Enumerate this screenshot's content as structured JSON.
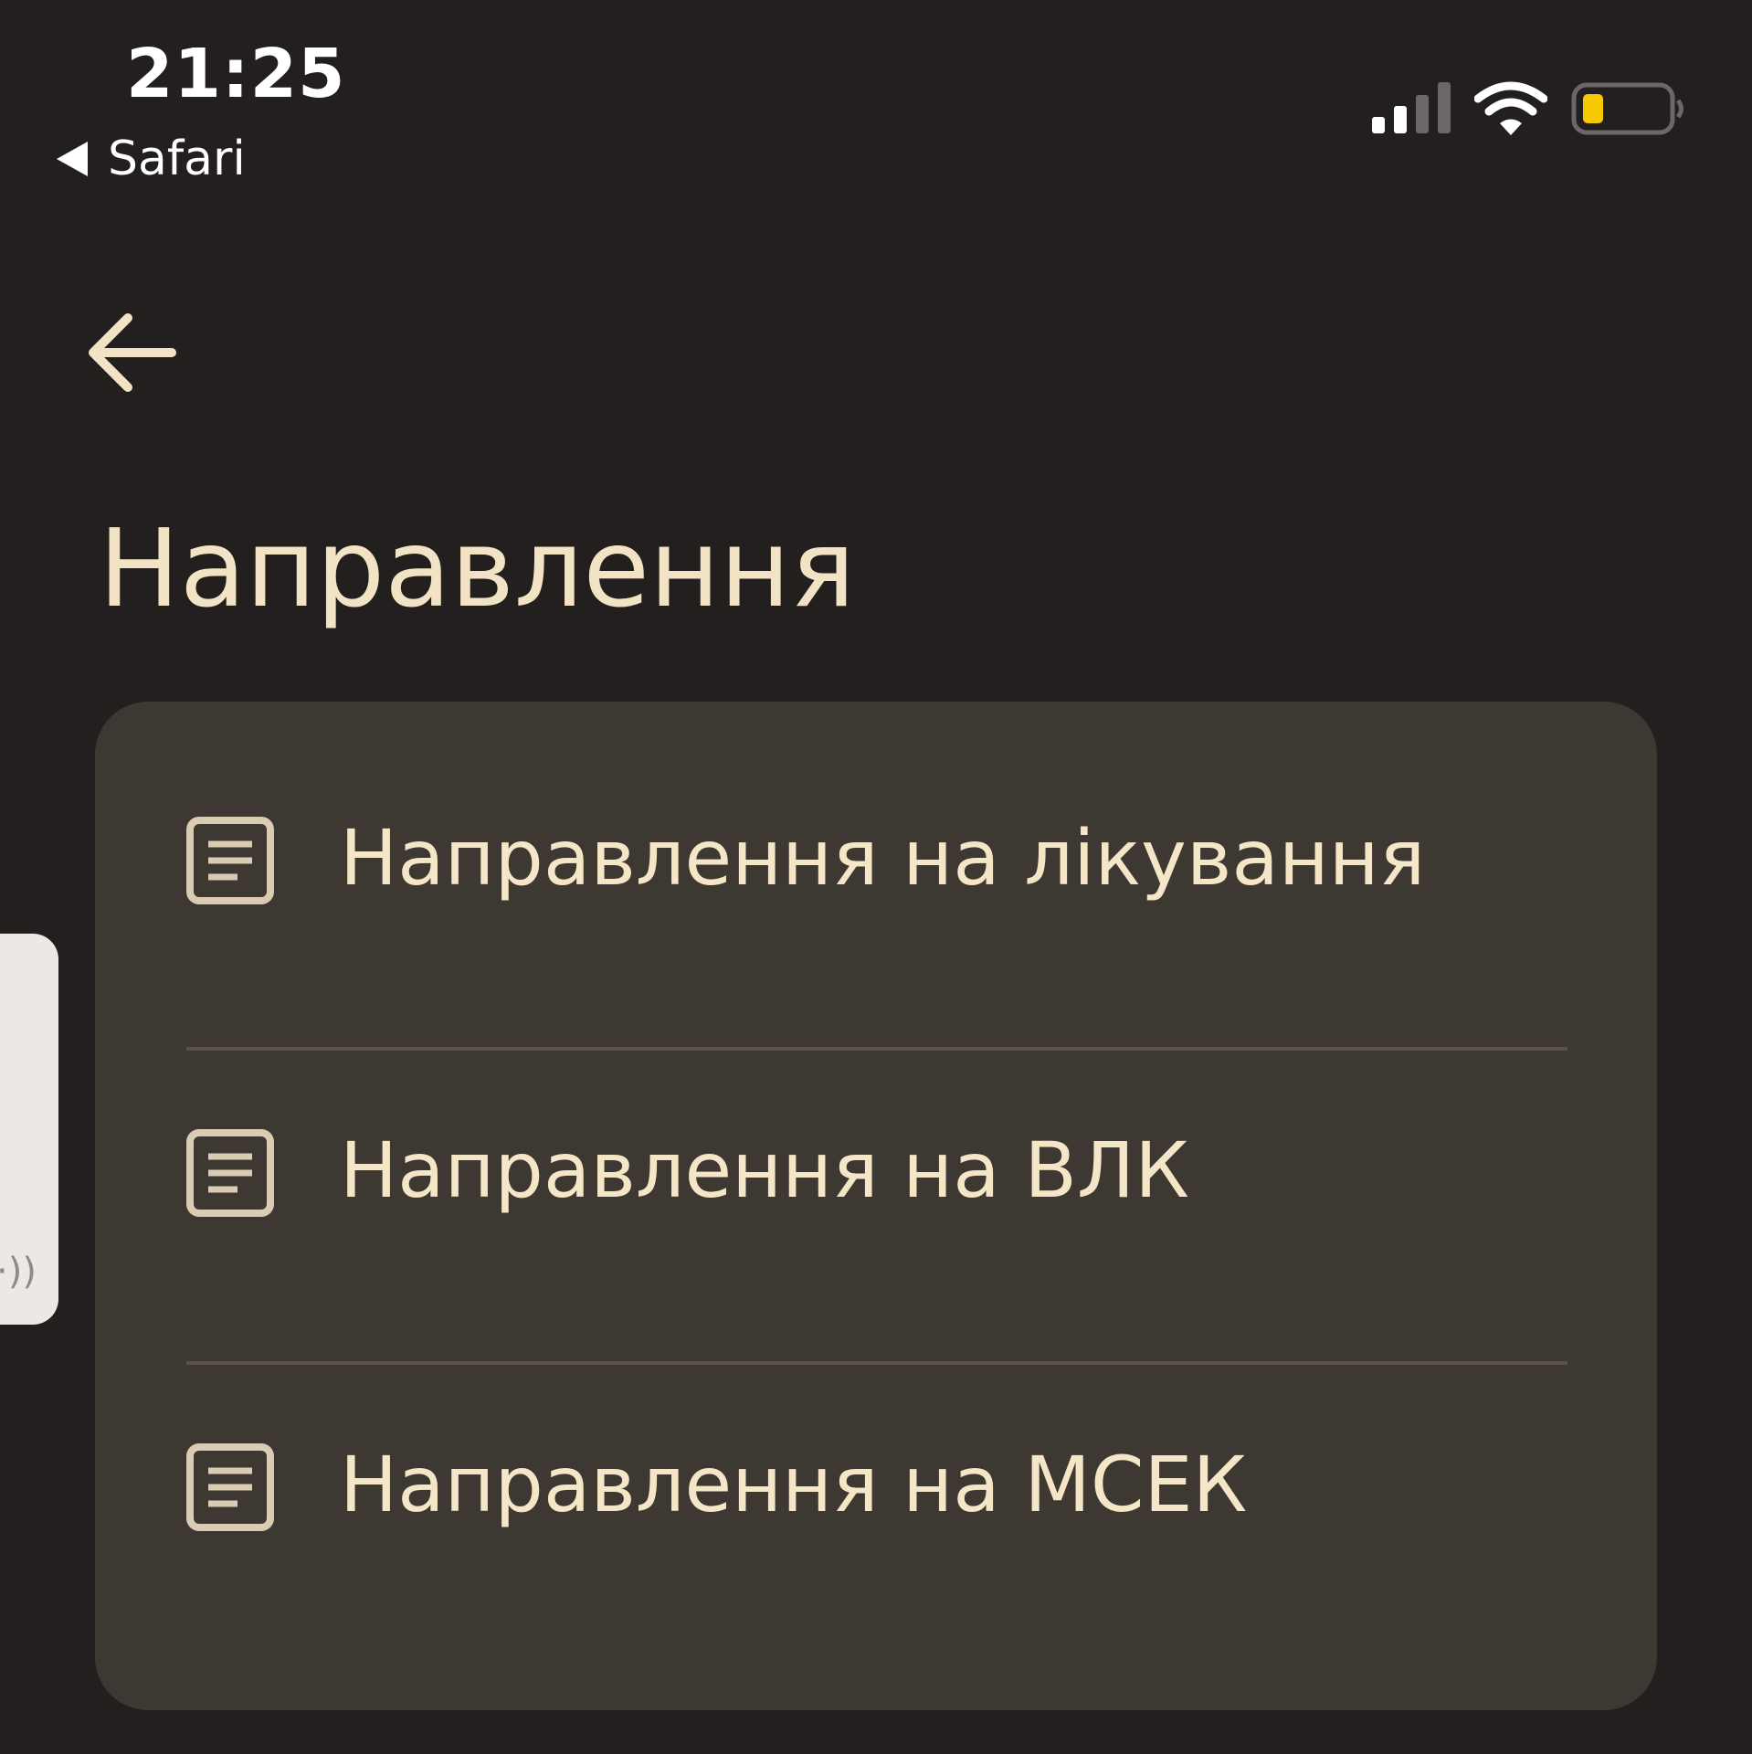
{
  "status_bar": {
    "time": "21:25",
    "back_app_label": "Safari",
    "signal_icon": "cellular-signal-icon",
    "wifi_icon": "wifi-icon",
    "battery_icon": "battery-low-icon",
    "battery_fill_fraction": 0.2,
    "battery_color": "#f5c800"
  },
  "header": {
    "back_icon": "arrow-left-icon",
    "title": "Направлення"
  },
  "menu": {
    "items": [
      {
        "label": "Направлення на лікування",
        "icon": "document-icon"
      },
      {
        "label": "Направлення на ВЛК",
        "icon": "document-icon"
      },
      {
        "label": "Направлення на МСЕК",
        "icon": "document-icon"
      }
    ]
  },
  "side_widget": {
    "symbol": "·))"
  },
  "colors": {
    "background": "#221f1e",
    "card": "#3e3832",
    "accent_text": "#f1e3c4",
    "divider": "#5a524b"
  }
}
